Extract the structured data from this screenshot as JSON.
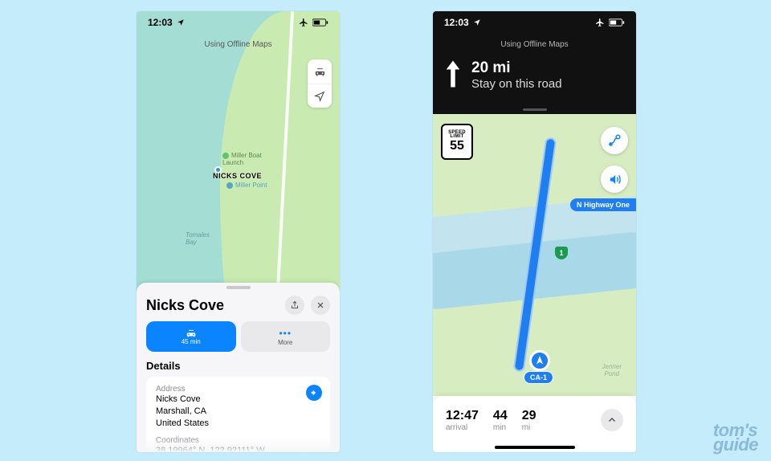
{
  "statusbar": {
    "time": "12:03"
  },
  "offline_msg": "Using Offline Maps",
  "left": {
    "map": {
      "label_nicks": "NICKS COVE",
      "label_miller_boat": "Miller Boat\nLaunch",
      "label_miller_pt": "Miller Point",
      "label_bay": "Tomales\nBay"
    },
    "sheet": {
      "title": "Nicks Cove",
      "drive_time": "45 min",
      "more": "More",
      "details_h": "Details",
      "address_lbl": "Address",
      "address_l1": "Nicks Cove",
      "address_l2": "Marshall, CA",
      "address_l3": "United States",
      "coords_lbl": "Coordinates",
      "coords_val": "38.19964° N, 122.92111° W"
    }
  },
  "right": {
    "nav": {
      "distance": "20 mi",
      "instruction": "Stay on this road"
    },
    "speed": {
      "l1": "SPEED",
      "l2": "LIMIT",
      "value": "55"
    },
    "map": {
      "hwy_label": "N Highway One",
      "shield": "1",
      "ca_label": "CA-1",
      "pond": "Jenner\nPond"
    },
    "trip": {
      "arrival_time": "12:47",
      "arrival_lbl": "arrival",
      "min_val": "44",
      "min_lbl": "min",
      "mi_val": "29",
      "mi_lbl": "mi"
    }
  },
  "watermark": {
    "l1": "tom's",
    "l2": "guide"
  }
}
